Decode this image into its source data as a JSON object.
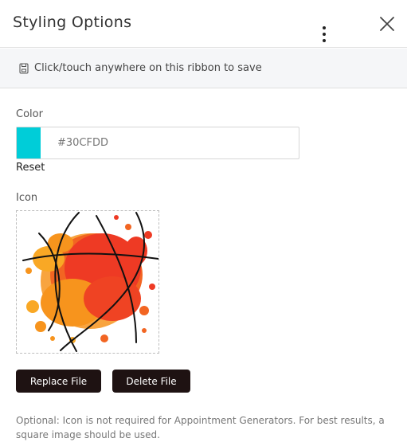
{
  "header": {
    "title": "Styling Options",
    "menu_icon": "kebab-vertical-icon",
    "close_icon": "close-icon"
  },
  "ribbon": {
    "icon": "save-icon",
    "text": "Click/touch anywhere on this ribbon to save"
  },
  "color": {
    "label": "Color",
    "value": "#30CFDD",
    "swatch_color": "#00CDD8",
    "reset_label": "Reset"
  },
  "icon_section": {
    "label": "Icon",
    "image": "basketball-paint-splash-image",
    "replace_label": "Replace File",
    "delete_label": "Delete File"
  },
  "note": "Optional: Icon is not required for Appointment Generators. For best results, a square image should be used."
}
